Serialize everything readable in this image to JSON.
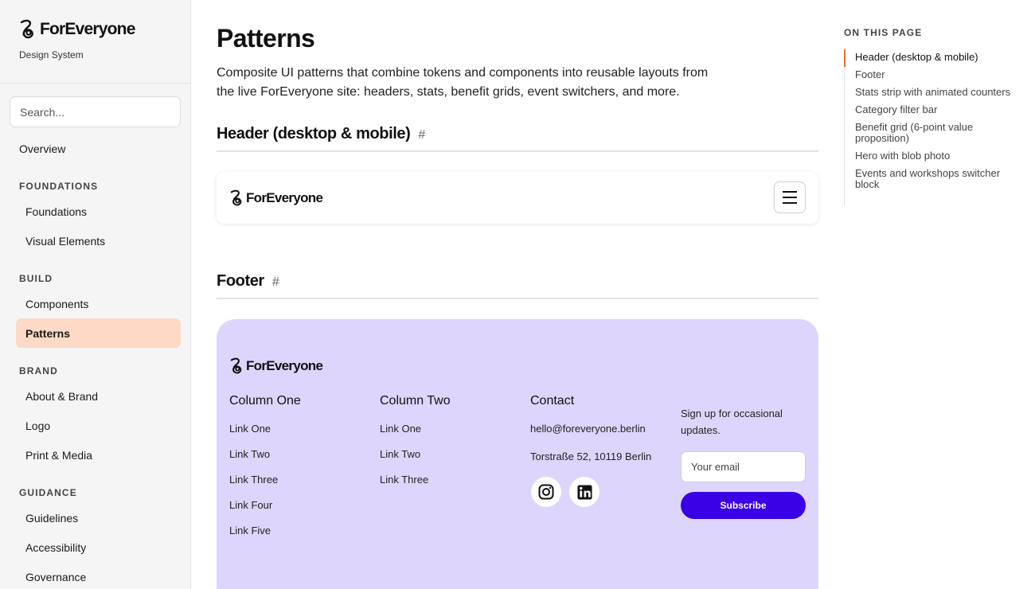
{
  "sidebar": {
    "brand_name": "ForEveryone",
    "brand_subtitle": "Design System",
    "search_placeholder": "Search...",
    "overview_label": "Overview",
    "sections": [
      {
        "title": "FOUNDATIONS",
        "items": [
          "Foundations",
          "Visual Elements"
        ]
      },
      {
        "title": "BUILD",
        "items": [
          "Components",
          "Patterns"
        ]
      },
      {
        "title": "BRAND",
        "items": [
          "About & Brand",
          "Logo",
          "Print & Media"
        ]
      },
      {
        "title": "GUIDANCE",
        "items": [
          "Guidelines",
          "Accessibility",
          "Governance"
        ]
      }
    ],
    "active_item": "Patterns"
  },
  "main": {
    "title": "Patterns",
    "description": "Composite UI patterns that combine tokens and components into reusable layouts from the live ForEveryone site: headers, stats, benefit grids, event switchers, and more.",
    "sections": [
      {
        "heading": "Header (desktop & mobile)",
        "anchor": "#"
      },
      {
        "heading": "Footer",
        "anchor": "#"
      }
    ],
    "header_demo": {
      "brand_name": "ForEveryone"
    },
    "footer_demo": {
      "brand_name": "ForEveryone",
      "column_one": {
        "title": "Column One",
        "links": [
          "Link One",
          "Link Two",
          "Link Three",
          "Link Four",
          "Link Five"
        ]
      },
      "column_two": {
        "title": "Column Two",
        "links": [
          "Link One",
          "Link Two",
          "Link Three"
        ]
      },
      "contact": {
        "title": "Contact",
        "email": "hello@foreveryone.berlin",
        "address": "Torstraße 52, 10119 Berlin"
      },
      "social_icons": [
        "instagram-icon",
        "linkedin-icon"
      ],
      "signup_text": "Sign up for occasional updates.",
      "email_placeholder": "Your email",
      "subscribe_label": "Subscribe",
      "background_color": "#ddd5fb",
      "button_color": "#3a00e6"
    }
  },
  "toc": {
    "title": "ON THIS PAGE",
    "items": [
      "Header (desktop & mobile)",
      "Footer",
      "Stats strip with animated counters",
      "Category filter bar",
      "Benefit grid (6-point value proposition)",
      "Hero with blob photo",
      "Events and workshops switcher block"
    ],
    "active_index": 0,
    "accent_color": "#f26a2e"
  },
  "colors": {
    "active_nav_bg": "#fdd9c6",
    "sidebar_bg": "#f5f5f5"
  }
}
